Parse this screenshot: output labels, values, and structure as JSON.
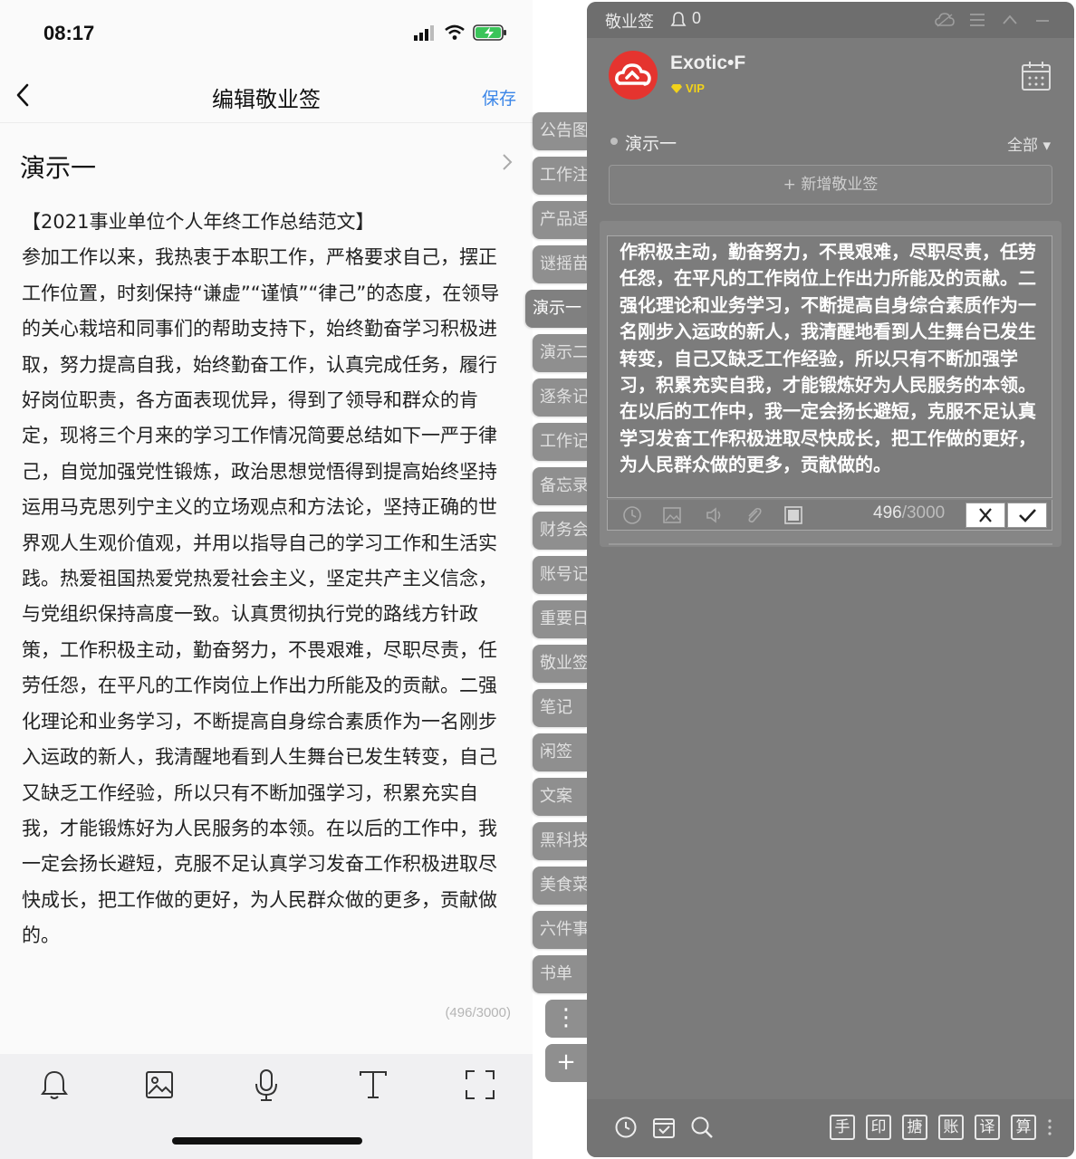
{
  "phone": {
    "status_time": "08:17",
    "nav_title": "编辑敬业签",
    "save_label": "保存",
    "note_title": "演示一",
    "note_body": "【2021事业单位个人年终工作总结范文】\n参加工作以来，我热衷于本职工作，严格要求自己，摆正工作位置，时刻保持“谦虚”“谨慎”“律己”的态度，在领导的关心栽培和同事们的帮助支持下，始终勤奋学习积极进取，努力提高自我，始终勤奋工作，认真完成任务，履行好岗位职责，各方面表现优异，得到了领导和群众的肯定，现将三个月来的学习工作情况简要总结如下一严于律己，自觉加强党性锻炼，政治思想觉悟得到提高始终坚持运用马克思列宁主义的立场观点和方法论，坚持正确的世界观人生观价值观，并用以指导自己的学习工作和生活实践。热爱祖国热爱党热爱社会主义，坚定共产主义信念，与党组织保持高度一致。认真贯彻执行党的路线方针政策，工作积极主动，勤奋努力，不畏艰难，尽职尽责，任劳任怨，在平凡的工作岗位上作出力所能及的贡献。二强化理论和业务学习，不断提高自身综合素质作为一名刚步入运政的新人，我清醒地看到人生舞台已发生转变，自己又缺乏工作经验，所以只有不断加强学习，积累充实自我，才能锻炼好为人民服务的本领。在以后的工作中，我一定会扬长避短，克服不足认真学习发奋工作积极进取尽快成长，把工作做的更好，为人民群众做的更多，贡献做的。",
    "char_count": "(496/3000)",
    "toolbar_icons": [
      "bell-icon",
      "image-icon",
      "microphone-icon",
      "text-format-icon",
      "fullscreen-icon"
    ]
  },
  "tabs": {
    "items": [
      "公告图",
      "工作注",
      "产品适",
      "谜摇苗",
      "演示一",
      "演示二",
      "逐条记",
      "工作记",
      "备忘录",
      "财务会",
      "账号记",
      "重要日",
      "敬业签",
      "笔记",
      "闲签",
      "文案",
      "黑科技",
      "美食菜",
      "六件事",
      "书单"
    ],
    "active_index": 4,
    "more_label": "⋮",
    "add_label": "+"
  },
  "panel": {
    "app_title": "敬业签",
    "notif_count": "0",
    "username": "Exotic•F",
    "vip_label": "VIP",
    "group_name": "演示一",
    "filter_label": "全部 ▾",
    "new_note_label": "+ 新增敬业签",
    "editor_text": "作积极主动，勤奋努力，不畏艰难，尽职尽责，任劳任怨，在平凡的工作岗位上作出力所能及的贡献。二强化理论和业务学习，不断提高自身综合素质作为一名刚步入运政的新人，我清醒地看到人生舞台已发生转变，自己又缺乏工作经验，所以只有不断加强学习，积累充实自我，才能锻炼好为人民服务的本领。在以后的工作中，我一定会扬长避短，克服不足认真学习发奋工作积极进取尽快成长，把工作做的更好，为人民群众做的更多，贡献做的。",
    "count_current": "496",
    "count_max": "/3000",
    "cancel_label": "✕",
    "confirm_label": "✓",
    "bottom_boxes": [
      "手",
      "印",
      "搪",
      "账",
      "译",
      "算"
    ]
  },
  "colors": {
    "accent_blue": "#3b86e8",
    "panel_gray": "#7b7b7b",
    "avatar_red": "#e5342f",
    "vip_yellow": "#f2d21a"
  }
}
